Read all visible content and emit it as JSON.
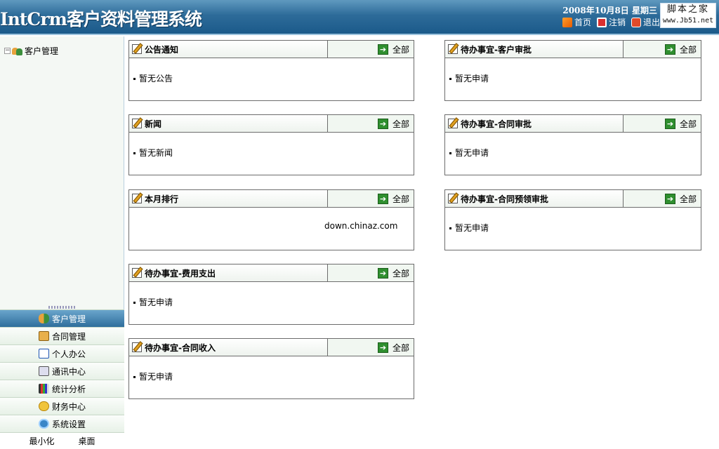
{
  "header": {
    "app_title": "IntCrm客户资料管理系统",
    "date": "2008年10月8日  星期三",
    "brand_top": "脚本之家",
    "brand_url": "www.Jb51.net",
    "links": [
      "首页",
      "注销",
      "退出"
    ]
  },
  "sidebar": {
    "tree_root": "客户管理",
    "tree_toggle": "−",
    "nav_items": [
      "客户管理",
      "合同管理",
      "个人办公",
      "通讯中心",
      "统计分析",
      "财务中心",
      "系统设置"
    ],
    "bottom": [
      "最小化",
      "桌面"
    ]
  },
  "panels": [
    {
      "title": "公告通知",
      "more": "全部",
      "content": "暂无公告"
    },
    {
      "title": "待办事宜-客户审批",
      "more": "全部",
      "content": "暂无申请"
    },
    {
      "title": "新闻",
      "more": "全部",
      "content": "暂无新闻"
    },
    {
      "title": "待办事宜-合同审批",
      "more": "全部",
      "content": "暂无申请"
    },
    {
      "title": "本月排行",
      "more": "全部",
      "content": "down.chinaz.com"
    },
    {
      "title": "待办事宜-合同预领审批",
      "more": "全部",
      "content": "暂无申请"
    },
    {
      "title": "待办事宜-费用支出",
      "more": "全部",
      "content": "暂无申请"
    },
    {
      "title": "待办事宜-合同收入",
      "more": "全部",
      "content": "暂无申请"
    }
  ]
}
